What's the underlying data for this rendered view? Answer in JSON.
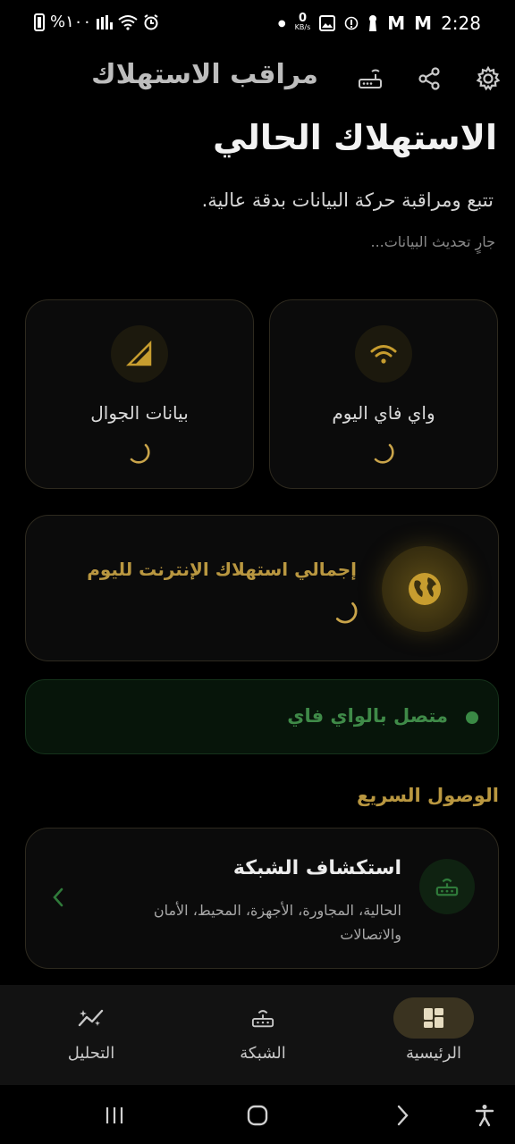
{
  "status_bar": {
    "battery_text": "%١٠٠",
    "time": "2:28",
    "net_speed_value": "0",
    "net_speed_unit": "KB/s"
  },
  "header": {
    "app_title": "مراقب الاستهلاك",
    "icons": [
      "settings-icon",
      "share-icon",
      "router-icon"
    ]
  },
  "main": {
    "title": "الاستهلاك الحالي",
    "subtitle": "تتبع ومراقبة حركة البيانات بدقة عالية.",
    "updating": "جارٍ تحديث البيانات..."
  },
  "cards": {
    "wifi": {
      "label": "واي فاي اليوم",
      "icon": "wifi-icon"
    },
    "mobile": {
      "label": "بيانات الجوال",
      "icon": "cellular-signal-icon"
    },
    "total": {
      "label": "إجمالي استهلاك الإنترنت لليوم",
      "icon": "globe-icon"
    }
  },
  "connection": {
    "text": "متصل بالواي فاي",
    "status_color": "#3a8a45"
  },
  "quick_access": {
    "heading": "الوصول السريع",
    "items": [
      {
        "title": "استكشاف الشبكة",
        "description": "الحالية، المجاورة، الأجهزة، المحيط، الأمان والاتصالات",
        "icon": "router-icon"
      }
    ]
  },
  "bottom_nav": [
    {
      "label": "الرئيسية",
      "icon": "dashboard-icon",
      "active": true
    },
    {
      "label": "الشبكة",
      "icon": "router-icon",
      "active": false
    },
    {
      "label": "التحليل",
      "icon": "analytics-icon",
      "active": false
    }
  ],
  "colors": {
    "accent": "#b99740",
    "background": "#000000",
    "connected": "#3f8a48"
  }
}
